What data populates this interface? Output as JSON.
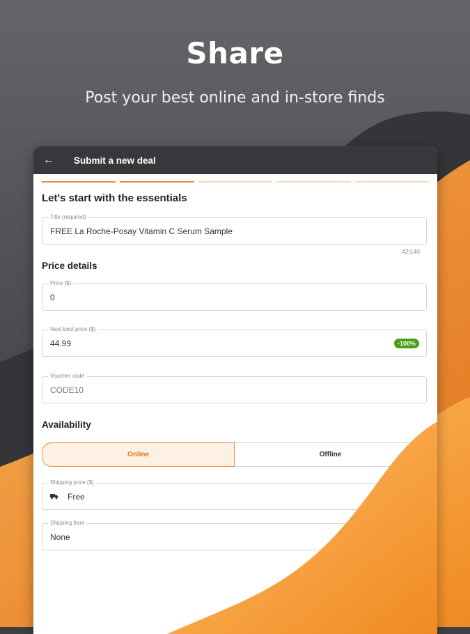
{
  "headline": "Share",
  "subline": "Post your best online and in-store finds",
  "colors": {
    "accent": "#f28a30",
    "dark": "#37383b",
    "badge": "#4a9d16"
  },
  "appbar": {
    "back_icon": "arrow-left-icon",
    "title": "Submit a new deal"
  },
  "progress": {
    "total_steps": 5,
    "completed_steps": 2
  },
  "essentials": {
    "heading": "Let's start with the essentials",
    "title_label": "Title (required)",
    "title_value": "FREE La Roche-Posay Vitamin C Serum Sample",
    "title_counter": "42/140"
  },
  "price": {
    "heading": "Price details",
    "price_label": "Price ($)",
    "price_value": "0",
    "next_best_label": "Next best price ($)",
    "next_best_value": "44.99",
    "discount_badge": "-100%",
    "voucher_label": "Voucher code",
    "voucher_placeholder": "CODE10"
  },
  "availability": {
    "heading": "Availability",
    "options": [
      "Online",
      "Offline"
    ],
    "selected": "Online",
    "shipping_price_label": "Shipping price ($)",
    "shipping_price_value": "Free",
    "shipping_icon": "truck-icon",
    "shipping_from_label": "Shipping from",
    "shipping_from_value": "None"
  }
}
